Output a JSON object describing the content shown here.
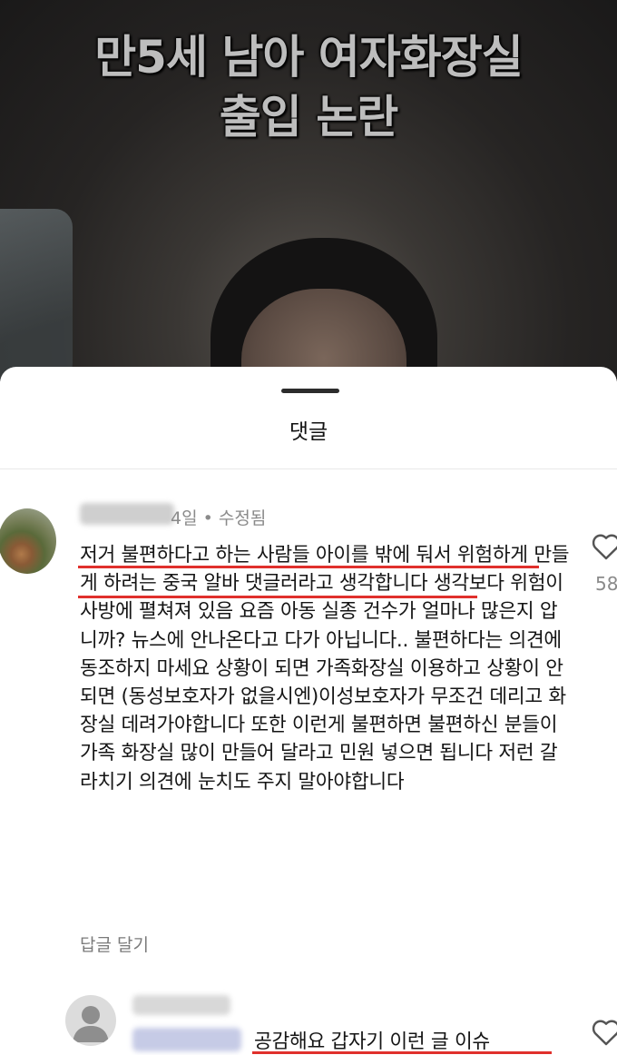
{
  "video": {
    "title_line1": "만5세 남아 여자화장실",
    "title_line2": "출입 논란"
  },
  "sheet": {
    "title": "댓글"
  },
  "comments": [
    {
      "meta": "4일 • 수정됨",
      "text": "저거 불편하다고 하는 사람들 아이를 밖에 둬서 위험하게 만들게 하려는 중국 알바 댓글러라고 생각합니다 생각보다 위험이 사방에 펼쳐져 있음 요즘 아동 실종 건수가 얼마나 많은지 압니까? 뉴스에 안나온다고 다가 아닙니다.. 불편하다는 의견에 동조하지 마세요 상황이 되면 가족화장실 이용하고 상황이 안되면 (동성보호자가 없을시엔)이성보호자가 무조건 데리고 화장실 데려가야합니다 또한 이런게 불편하면 불편하신 분들이 가족 화장실 많이 만들어 달라고 민원 넣으면 됩니다 저런 갈라치기 의견에 눈치도 주지 말아야합니다",
      "reply_label": "답글 달기",
      "likes": "58",
      "heart_icon": "heart-outline-icon"
    },
    {
      "text": "공감해요 갑자기 이런 글 이슈",
      "heart_icon": "heart-outline-icon"
    }
  ],
  "colors": {
    "underline": "#e0302c",
    "meta_text": "#8a8a8a"
  }
}
